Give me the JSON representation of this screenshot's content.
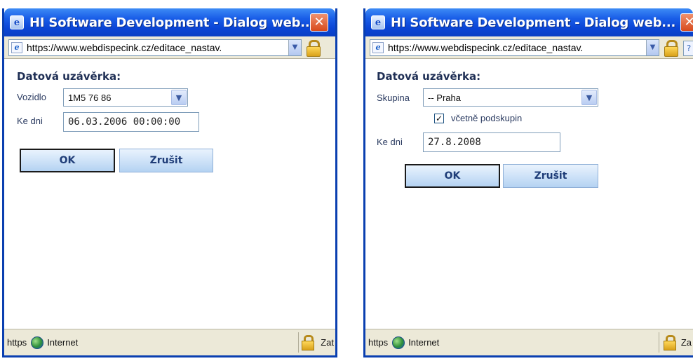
{
  "left_window": {
    "title": "HI Software Development - Dialog web...",
    "url": "https://www.webdispecink.cz/editace_nastav.",
    "section_title": "Datová uzávěrka:",
    "vehicle_label": "Vozidlo",
    "vehicle_value": "1M5 76 86",
    "date_label": "Ke dni",
    "date_value": "06.03.2006 00:00:00",
    "ok_label": "OK",
    "cancel_label": "Zrušit",
    "status": {
      "protocol": "https",
      "zone": "Internet",
      "tail": "Zat"
    }
  },
  "right_window": {
    "title": "HI Software Development - Dialog web...",
    "url": "https://www.webdispecink.cz/editace_nastav.",
    "section_title": "Datová uzávěrka:",
    "group_label": "Skupina",
    "group_value": "-- Praha",
    "include_subgroups_label": "včetně podskupin",
    "include_subgroups_checked": true,
    "date_label": "Ke dni",
    "date_value": "27.8.2008",
    "ok_label": "OK",
    "cancel_label": "Zrušit",
    "status": {
      "protocol": "https",
      "zone": "Internet",
      "tail": "Za"
    }
  },
  "icons": {
    "close": "close-icon",
    "page": "page-icon",
    "lock": "lock-icon",
    "globe": "globe-icon",
    "dropdown": "chevron-down-icon",
    "checkmark": "checkmark-icon"
  },
  "colors": {
    "titlebar": "#0a45d6",
    "close": "#d84a1c",
    "button_top": "#e9f3fd",
    "button_bottom": "#b4d2f2",
    "chrome": "#ece9d8"
  }
}
